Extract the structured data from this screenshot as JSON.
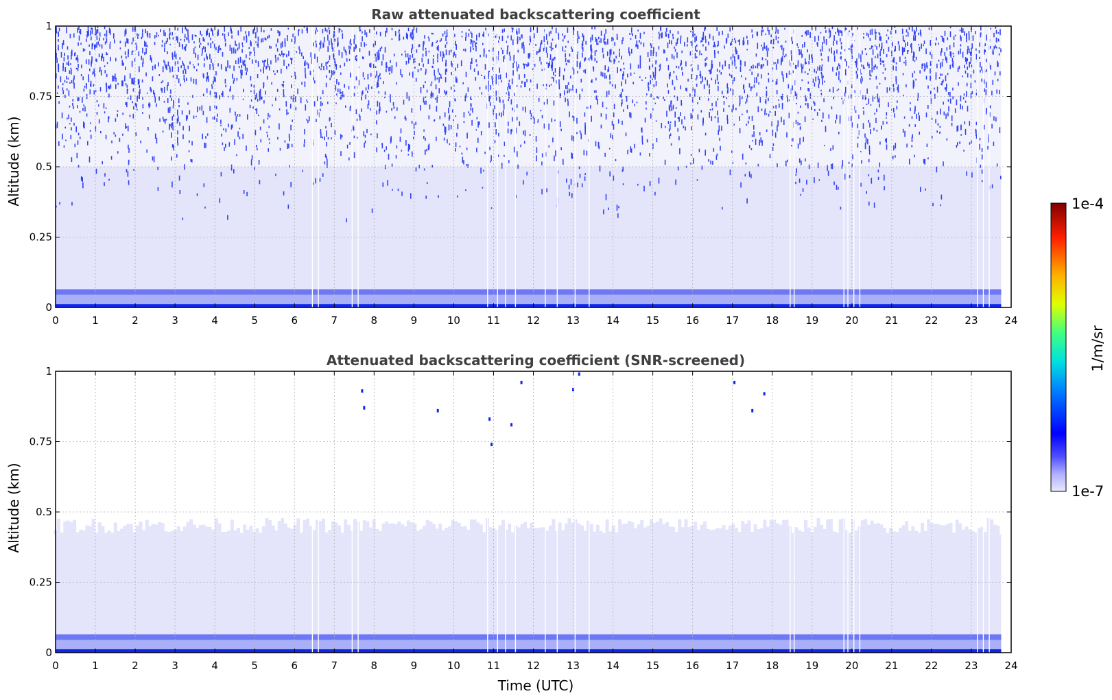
{
  "chart_data": [
    {
      "type": "heatmap",
      "title": "Raw attenuated backscattering coefficient",
      "xlabel": "",
      "ylabel": "Altitude (km)",
      "xlim": [
        0,
        24
      ],
      "ylim": [
        0,
        1
      ],
      "xticks": [
        "0",
        "1",
        "2",
        "3",
        "4",
        "5",
        "6",
        "7",
        "8",
        "9",
        "10",
        "11",
        "12",
        "13",
        "14",
        "15",
        "16",
        "17",
        "18",
        "19",
        "20",
        "21",
        "22",
        "23",
        "24"
      ],
      "yticks": [
        "0",
        "0.25",
        "0.5",
        "0.75",
        "1"
      ],
      "grid": true,
      "data_end_hour": 23.75,
      "layers": [
        {
          "bottom": 0.0,
          "top": 0.012,
          "level": "dark-blue"
        },
        {
          "bottom": 0.012,
          "top": 0.045,
          "level": "light-blue"
        },
        {
          "bottom": 0.045,
          "top": 0.065,
          "level": "medium-blue"
        },
        {
          "bottom": 0.065,
          "top": 0.5,
          "level": "background"
        },
        {
          "bottom": 0.5,
          "top": 1.0,
          "level": "noise"
        }
      ]
    },
    {
      "type": "heatmap",
      "title": "Attenuated backscattering coefficient (SNR-screened)",
      "xlabel": "Time (UTC)",
      "ylabel": "Altitude (km)",
      "xlim": [
        0,
        24
      ],
      "ylim": [
        0,
        1
      ],
      "xticks": [
        "0",
        "1",
        "2",
        "3",
        "4",
        "5",
        "6",
        "7",
        "8",
        "9",
        "10",
        "11",
        "12",
        "13",
        "14",
        "15",
        "16",
        "17",
        "18",
        "19",
        "20",
        "21",
        "22",
        "23",
        "24"
      ],
      "yticks": [
        "0",
        "0.25",
        "0.5",
        "0.75",
        "1"
      ],
      "grid": true,
      "data_end_hour": 23.75,
      "screened_top_km": 0.42,
      "isolated_points": [
        {
          "x": 7.7,
          "y": 0.93
        },
        {
          "x": 7.75,
          "y": 0.87
        },
        {
          "x": 9.6,
          "y": 0.86
        },
        {
          "x": 10.9,
          "y": 0.83
        },
        {
          "x": 10.95,
          "y": 0.74
        },
        {
          "x": 11.45,
          "y": 0.81
        },
        {
          "x": 11.7,
          "y": 0.96
        },
        {
          "x": 13.0,
          "y": 0.935
        },
        {
          "x": 13.15,
          "y": 0.99
        },
        {
          "x": 17.05,
          "y": 0.96
        },
        {
          "x": 17.8,
          "y": 0.92
        },
        {
          "x": 17.5,
          "y": 0.86
        }
      ]
    }
  ],
  "colorbar": {
    "label": "1/m/sr",
    "min_label": "1e-7",
    "max_label": "1e-4",
    "colormap": "jet-with-light-low-end"
  },
  "colors": {
    "background": "#e4e4fa",
    "light_blue": "#aab0f8",
    "medium_blue": "#6f78f4",
    "dark_blue": "#1026ee"
  }
}
